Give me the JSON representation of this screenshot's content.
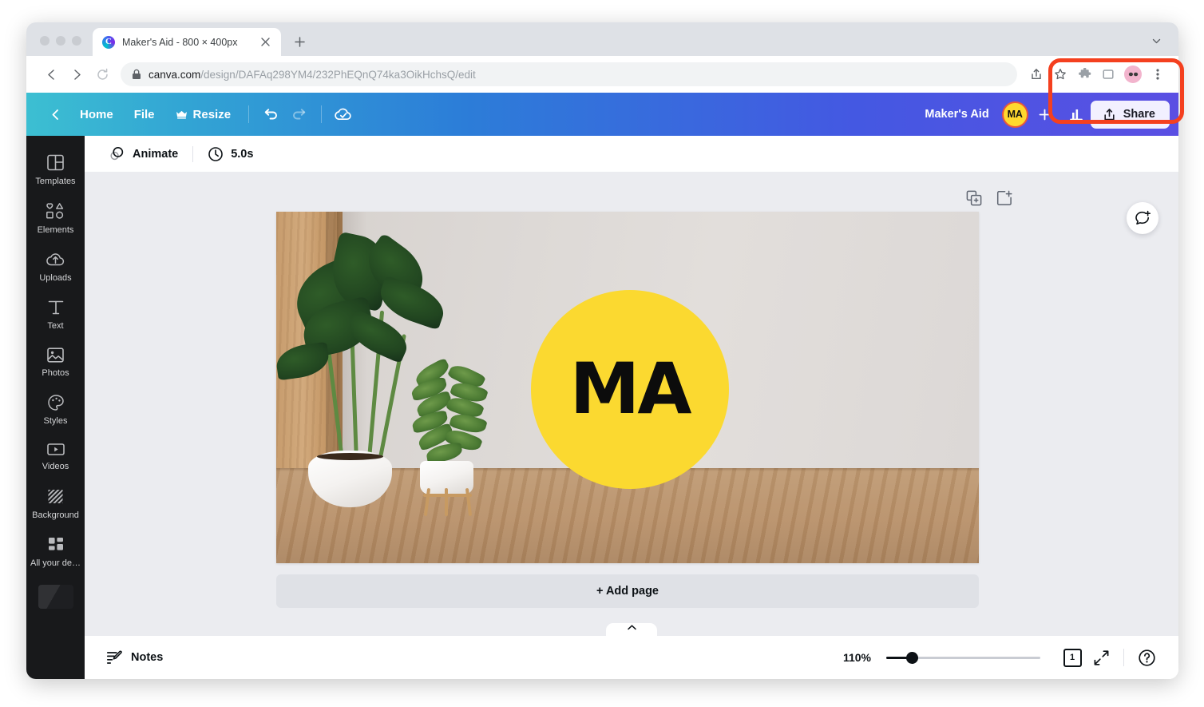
{
  "browser": {
    "tab": {
      "title": "Maker's Aid - 800 × 400px",
      "favicon_letter": "C"
    },
    "new_tab_label": "+",
    "url_host": "canva.com",
    "url_path": "/design/DAFAq298YM4/232PhEQnQ74ka3OikHchsQ/edit",
    "icons": {
      "back": "back-arrow-icon",
      "forward": "forward-arrow-icon",
      "reload": "reload-icon",
      "lock": "lock-icon",
      "share": "share-icon",
      "bookmark": "star-icon",
      "extensions": "puzzle-piece-icon",
      "window": "window-icon",
      "profile": "profile-avatar-icon",
      "menu": "kebab-menu-icon",
      "tabstrip_chevron": "chevron-down-icon"
    }
  },
  "appbar": {
    "back_label": "",
    "home_label": "Home",
    "file_label": "File",
    "resize_label": "Resize",
    "resize_badge": "crown-icon",
    "undo_label": "undo-icon",
    "redo_label": "redo-icon",
    "saved_label": "cloud-saved-icon",
    "account_name": "Maker's Aid",
    "avatar_initials": "MA",
    "add_member_label": "+",
    "insights_label": "insights-icon",
    "share_label": "Share",
    "gradient_start": "#3cbfd2",
    "gradient_mid": "#2c7dd8",
    "gradient_end": "#5a4fe3",
    "annotation_color": "#f4401f"
  },
  "sidebar": {
    "items": [
      {
        "label": "Templates",
        "icon": "templates-icon"
      },
      {
        "label": "Elements",
        "icon": "elements-icon"
      },
      {
        "label": "Uploads",
        "icon": "uploads-icon"
      },
      {
        "label": "Text",
        "icon": "text-icon"
      },
      {
        "label": "Photos",
        "icon": "photos-icon"
      },
      {
        "label": "Styles",
        "icon": "styles-icon"
      },
      {
        "label": "Videos",
        "icon": "videos-icon"
      },
      {
        "label": "Background",
        "icon": "background-icon"
      },
      {
        "label": "All your de…",
        "icon": "all-your-designs-icon"
      }
    ]
  },
  "toolbar": {
    "animate_label": "Animate",
    "animate_icon": "animate-icon",
    "duration_label": "5.0s",
    "duration_icon": "clock-icon"
  },
  "canvas": {
    "page_tools": {
      "duplicate": "duplicate-page-icon",
      "add": "add-page-icon"
    },
    "comment_fab": "add-comment-icon",
    "logo_text": "MA",
    "logo_circle_color": "#fbd930",
    "logo_text_color": "#0c0c0c",
    "add_page_label": "+ Add page",
    "collapse_label": "⌃"
  },
  "statusbar": {
    "notes_label": "Notes",
    "notes_icon": "notes-icon",
    "zoom_value": "110%",
    "page_count": "1",
    "fullscreen_icon": "fullscreen-icon",
    "help_icon": "help-icon"
  }
}
